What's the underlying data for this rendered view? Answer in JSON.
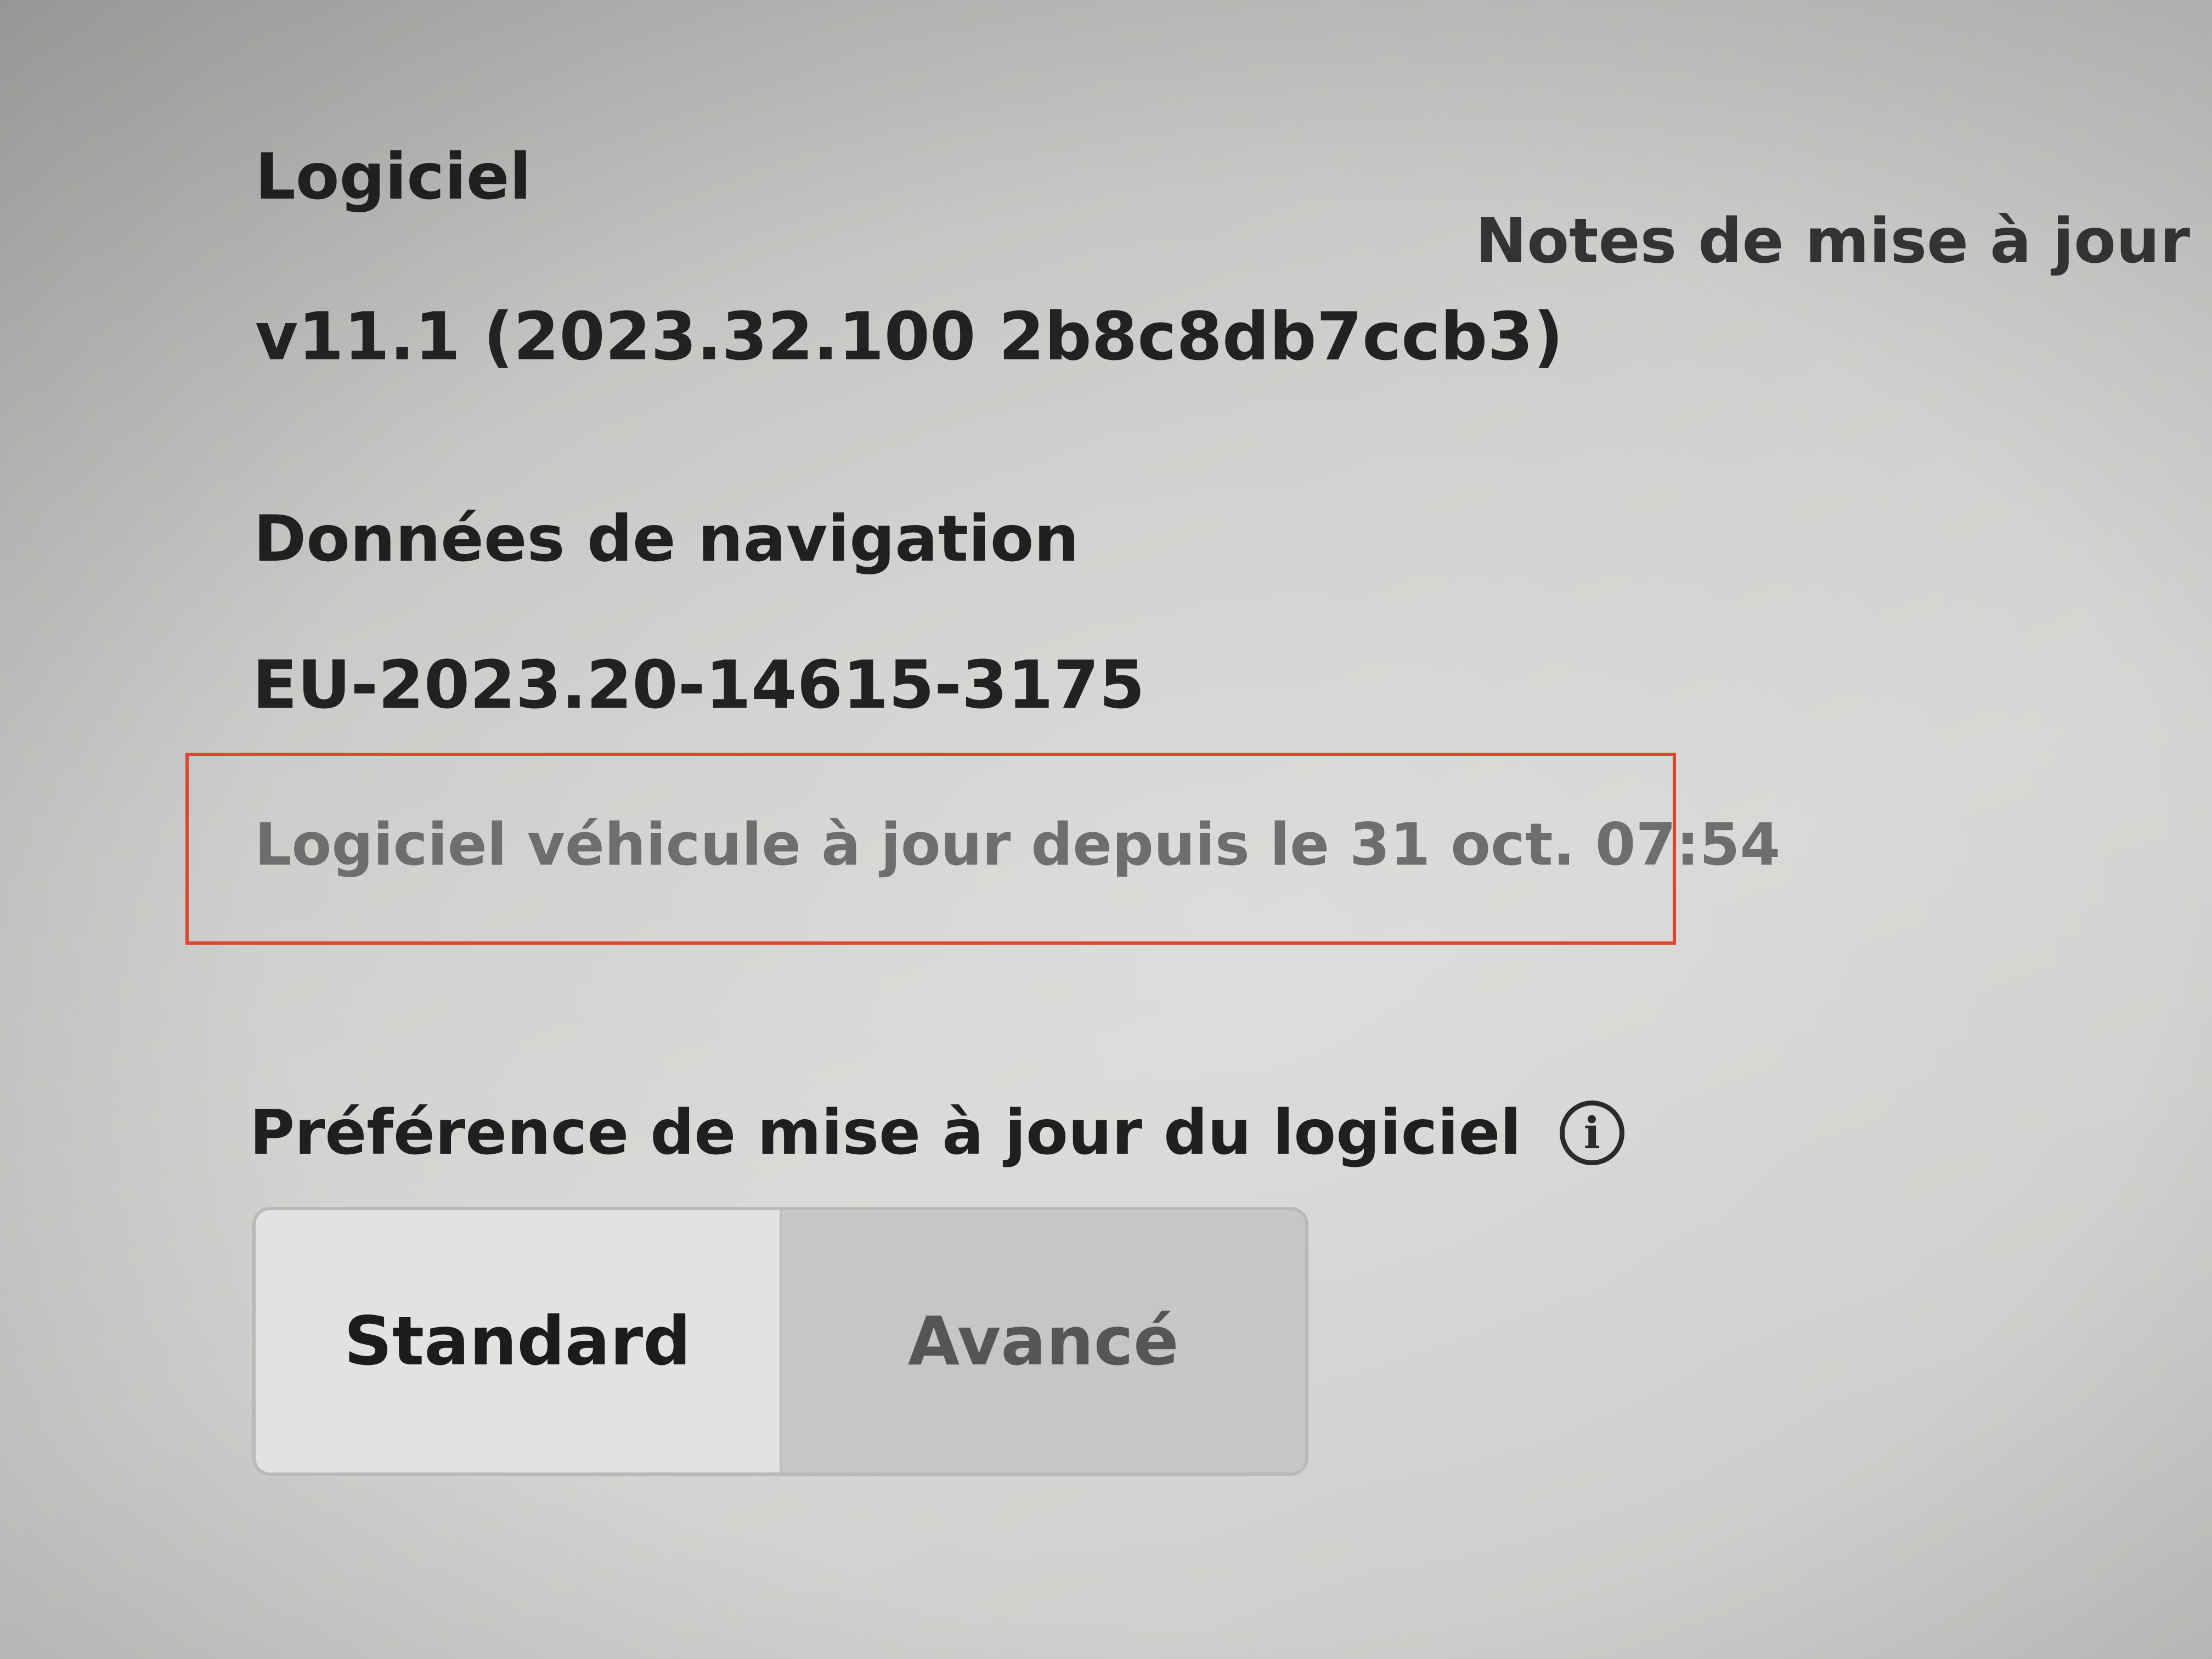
{
  "software": {
    "title": "Logiciel",
    "version": "v11.1 (2023.32.100 2b8c8db7ccb3)",
    "release_notes_label": "Notes de mise à jour"
  },
  "navigation_data": {
    "title": "Données de navigation",
    "version": "EU-2023.20-14615-3175"
  },
  "status": {
    "text": "Logiciel véhicule à jour depuis le 31 oct. 07:54",
    "highlight_color": "#e0462f"
  },
  "update_preference": {
    "title": "Préférence de mise à jour du logiciel",
    "info_icon": "ⓘ",
    "options": [
      {
        "label": "Standard",
        "selected": true
      },
      {
        "label": "Avancé",
        "selected": false
      }
    ]
  }
}
